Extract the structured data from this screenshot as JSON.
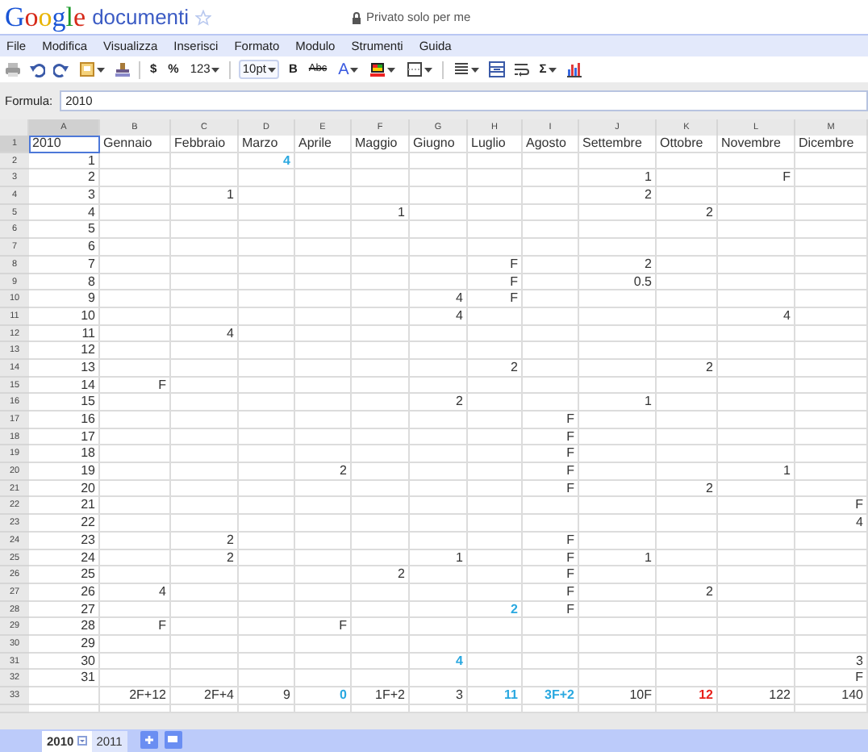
{
  "header": {
    "logo": "Google",
    "product": "documenti",
    "sharing": "Privato solo per me"
  },
  "menu": [
    "File",
    "Modifica",
    "Visualizza",
    "Inserisci",
    "Formato",
    "Modulo",
    "Strumenti",
    "Guida"
  ],
  "toolbar": [
    {
      "kind": "print"
    },
    {
      "kind": "undo"
    },
    {
      "kind": "redo"
    },
    {
      "kind": "paint",
      "dropdown": true
    },
    {
      "kind": "clear"
    },
    {
      "kind": "sep"
    },
    {
      "kind": "text",
      "label": "$"
    },
    {
      "kind": "text",
      "label": "%"
    },
    {
      "kind": "text",
      "label": "123",
      "dropdown": true
    },
    {
      "kind": "sep"
    },
    {
      "kind": "boxed",
      "label": "10pt",
      "dropdown": true
    },
    {
      "kind": "bold",
      "label": "B"
    },
    {
      "kind": "strike",
      "label": "Abc"
    },
    {
      "kind": "color",
      "label": "A",
      "dropdown": true
    },
    {
      "kind": "fill",
      "dropdown": true
    },
    {
      "kind": "borders",
      "dropdown": true
    },
    {
      "kind": "sep"
    },
    {
      "kind": "align",
      "dropdown": true
    },
    {
      "kind": "merge"
    },
    {
      "kind": "wrap"
    },
    {
      "kind": "text",
      "label": "Σ",
      "dropdown": true
    },
    {
      "kind": "chart"
    }
  ],
  "formula": {
    "label": "Formula:",
    "value": "2010"
  },
  "columns": [
    {
      "label": "A",
      "selected": true
    },
    {
      "label": "B",
      "selected": false
    },
    {
      "label": "C",
      "selected": false
    },
    {
      "label": "D",
      "selected": false
    },
    {
      "label": "E",
      "selected": false
    },
    {
      "label": "F",
      "selected": false
    },
    {
      "label": "G",
      "selected": false
    },
    {
      "label": "H",
      "selected": false
    },
    {
      "label": "I",
      "selected": false
    },
    {
      "label": "J",
      "selected": false
    },
    {
      "label": "K",
      "selected": false
    },
    {
      "label": "L",
      "selected": false
    },
    {
      "label": "M",
      "selected": false
    }
  ],
  "rows": [
    {
      "number": "1",
      "selected": true,
      "kind": "header",
      "cells": [
        {
          "text": "2010"
        },
        {
          "text": "Gennaio"
        },
        {
          "text": "Febbraio"
        },
        {
          "text": "Marzo"
        },
        {
          "text": "Aprile"
        },
        {
          "text": "Maggio"
        },
        {
          "text": "Giugno"
        },
        {
          "text": "Luglio"
        },
        {
          "text": "Agosto"
        },
        {
          "text": "Settembre"
        },
        {
          "text": "Ottobre"
        },
        {
          "text": "Novembre"
        },
        {
          "text": "Dicembre"
        }
      ]
    },
    {
      "number": "2",
      "selected": false,
      "cells": [
        {
          "text": "1"
        },
        {},
        {},
        {
          "text": "4",
          "color": "#29a8e0"
        }
      ]
    },
    {
      "number": "3",
      "selected": false,
      "cells": [
        {
          "text": "2"
        },
        {},
        {},
        {},
        {},
        {},
        {},
        {},
        {},
        {
          "text": "1"
        },
        {},
        {
          "text": "F"
        }
      ]
    },
    {
      "number": "4",
      "selected": false,
      "cells": [
        {
          "text": "3"
        },
        {},
        {
          "text": "1"
        },
        {},
        {},
        {},
        {},
        {},
        {},
        {
          "text": "2"
        }
      ]
    },
    {
      "number": "5",
      "selected": false,
      "cells": [
        {
          "text": "4"
        },
        {},
        {},
        {},
        {},
        {
          "text": "1"
        },
        {},
        {},
        {},
        {},
        {
          "text": "2"
        }
      ]
    },
    {
      "number": "6",
      "selected": false,
      "cells": [
        {
          "text": "5"
        }
      ]
    },
    {
      "number": "7",
      "selected": false,
      "cells": [
        {
          "text": "6"
        }
      ]
    },
    {
      "number": "8",
      "selected": false,
      "cells": [
        {
          "text": "7"
        },
        {},
        {},
        {},
        {},
        {},
        {},
        {
          "text": "F"
        },
        {},
        {
          "text": "2"
        }
      ]
    },
    {
      "number": "9",
      "selected": false,
      "cells": [
        {
          "text": "8"
        },
        {},
        {},
        {},
        {},
        {},
        {},
        {
          "text": "F"
        },
        {},
        {
          "text": "0.5"
        }
      ]
    },
    {
      "number": "10",
      "selected": false,
      "cells": [
        {
          "text": "9"
        },
        {},
        {},
        {},
        {},
        {},
        {
          "text": "4"
        },
        {
          "text": "F"
        }
      ]
    },
    {
      "number": "11",
      "selected": false,
      "cells": [
        {
          "text": "10"
        },
        {},
        {},
        {},
        {},
        {},
        {
          "text": "4"
        },
        {},
        {},
        {},
        {},
        {
          "text": "4"
        }
      ]
    },
    {
      "number": "12",
      "selected": false,
      "cells": [
        {
          "text": "11"
        },
        {},
        {
          "text": "4"
        }
      ]
    },
    {
      "number": "13",
      "selected": false,
      "cells": [
        {
          "text": "12"
        }
      ]
    },
    {
      "number": "14",
      "selected": false,
      "cells": [
        {
          "text": "13"
        },
        {},
        {},
        {},
        {},
        {},
        {},
        {
          "text": "2"
        },
        {},
        {},
        {
          "text": "2"
        }
      ]
    },
    {
      "number": "15",
      "selected": false,
      "cells": [
        {
          "text": "14"
        },
        {
          "text": "F"
        }
      ]
    },
    {
      "number": "16",
      "selected": false,
      "cells": [
        {
          "text": "15"
        },
        {},
        {},
        {},
        {},
        {},
        {
          "text": "2"
        },
        {},
        {},
        {
          "text": "1"
        }
      ]
    },
    {
      "number": "17",
      "selected": false,
      "cells": [
        {
          "text": "16"
        },
        {},
        {},
        {},
        {},
        {},
        {},
        {},
        {
          "text": "F"
        }
      ]
    },
    {
      "number": "18",
      "selected": false,
      "cells": [
        {
          "text": "17"
        },
        {},
        {},
        {},
        {},
        {},
        {},
        {},
        {
          "text": "F"
        }
      ]
    },
    {
      "number": "19",
      "selected": false,
      "cells": [
        {
          "text": "18"
        },
        {},
        {},
        {},
        {},
        {},
        {},
        {},
        {
          "text": "F"
        }
      ]
    },
    {
      "number": "20",
      "selected": false,
      "cells": [
        {
          "text": "19"
        },
        {},
        {},
        {},
        {
          "text": "2"
        },
        {},
        {},
        {},
        {
          "text": "F"
        },
        {},
        {},
        {
          "text": "1"
        }
      ]
    },
    {
      "number": "21",
      "selected": false,
      "cells": [
        {
          "text": "20"
        },
        {},
        {},
        {},
        {},
        {},
        {},
        {},
        {
          "text": "F"
        },
        {},
        {
          "text": "2"
        }
      ]
    },
    {
      "number": "22",
      "selected": false,
      "cells": [
        {
          "text": "21"
        },
        {},
        {},
        {},
        {},
        {},
        {},
        {},
        {},
        {},
        {},
        {},
        {
          "text": "F"
        }
      ]
    },
    {
      "number": "23",
      "selected": false,
      "cells": [
        {
          "text": "22"
        },
        {},
        {},
        {},
        {},
        {},
        {},
        {},
        {},
        {},
        {},
        {},
        {
          "text": "4"
        }
      ]
    },
    {
      "number": "24",
      "selected": false,
      "cells": [
        {
          "text": "23"
        },
        {},
        {
          "text": "2"
        },
        {},
        {},
        {},
        {},
        {},
        {
          "text": "F"
        }
      ]
    },
    {
      "number": "25",
      "selected": false,
      "cells": [
        {
          "text": "24"
        },
        {},
        {
          "text": "2"
        },
        {},
        {},
        {},
        {
          "text": "1"
        },
        {},
        {
          "text": "F"
        },
        {
          "text": "1"
        }
      ]
    },
    {
      "number": "26",
      "selected": false,
      "cells": [
        {
          "text": "25"
        },
        {},
        {},
        {},
        {},
        {
          "text": "2"
        },
        {},
        {},
        {
          "text": "F"
        }
      ]
    },
    {
      "number": "27",
      "selected": false,
      "cells": [
        {
          "text": "26"
        },
        {
          "text": "4"
        },
        {},
        {},
        {},
        {},
        {},
        {},
        {
          "text": "F"
        },
        {},
        {
          "text": "2"
        }
      ]
    },
    {
      "number": "28",
      "selected": false,
      "cells": [
        {
          "text": "27"
        },
        {},
        {},
        {},
        {},
        {},
        {},
        {
          "text": "2",
          "color": "#29a8e0"
        },
        {
          "text": "F"
        }
      ]
    },
    {
      "number": "29",
      "selected": false,
      "cells": [
        {
          "text": "28"
        },
        {
          "text": "F"
        },
        {},
        {},
        {
          "text": "F"
        }
      ]
    },
    {
      "number": "30",
      "selected": false,
      "cells": [
        {
          "text": "29"
        }
      ]
    },
    {
      "number": "31",
      "selected": false,
      "cells": [
        {
          "text": "30"
        },
        {},
        {},
        {},
        {},
        {},
        {
          "text": "4",
          "color": "#29a8e0"
        },
        {},
        {},
        {},
        {},
        {},
        {
          "text": "3"
        }
      ]
    },
    {
      "number": "32",
      "selected": false,
      "cells": [
        {
          "text": "31"
        },
        {},
        {},
        {},
        {},
        {},
        {},
        {},
        {},
        {},
        {},
        {},
        {
          "text": "F"
        }
      ]
    },
    {
      "number": "33",
      "selected": false,
      "cells": [
        {},
        {
          "text": "2F+12"
        },
        {
          "text": "2F+4"
        },
        {
          "text": "9"
        },
        {
          "text": "0",
          "color": "#29a8e0"
        },
        {
          "text": "1F+2"
        },
        {
          "text": "3"
        },
        {
          "text": "11",
          "color": "#29a8e0"
        },
        {
          "text": "3F+2",
          "color": "#29a8e0"
        },
        {
          "text": "10F"
        },
        {
          "text": "12",
          "color": "#e8201a"
        },
        {
          "text": "122"
        },
        {
          "text": "140"
        }
      ]
    }
  ],
  "sheets": [
    {
      "label": "2010",
      "selected": true
    },
    {
      "label": "2011",
      "selected": false
    }
  ]
}
